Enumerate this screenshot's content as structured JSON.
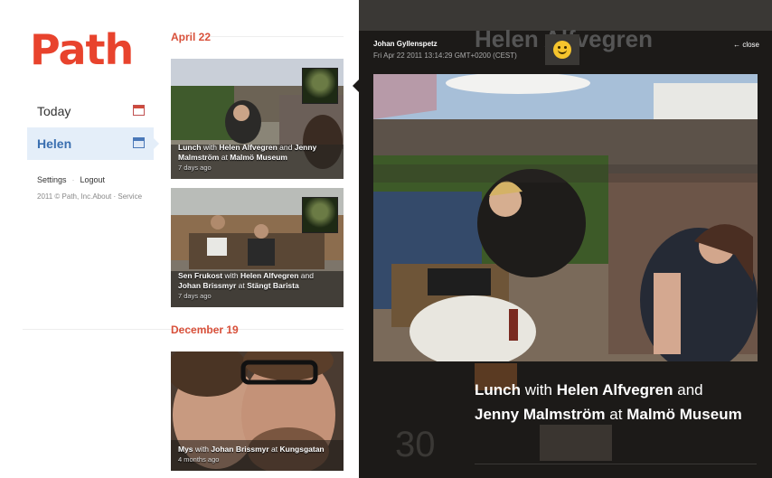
{
  "brand": {
    "logo_text": "Path"
  },
  "nav": {
    "items": [
      {
        "label": "Today"
      },
      {
        "label": "Helen"
      }
    ],
    "settings": "Settings",
    "logout": "Logout",
    "copyright": "2011 © Path, Inc.About · Service"
  },
  "feed": {
    "groups": [
      {
        "date": "April 22",
        "cards": [
          {
            "verb": "Lunch",
            "w1": "with",
            "p1": "Helen Alfvegren",
            "and": "and",
            "p2": "Jenny Malmström",
            "at": "at",
            "place": "Malmö Museum",
            "ago": "7 days ago"
          },
          {
            "verb": "Sen Frukost",
            "w1": "with",
            "p1": "Helen Alfvegren",
            "and": "and",
            "p2": "Johan Brissmyr",
            "at": "at",
            "place": "Stängt Barista",
            "ago": "7 days ago"
          }
        ]
      },
      {
        "date": "December 19",
        "cards": [
          {
            "verb": "Mys",
            "w1": "with",
            "p1": "Johan Brissmyr",
            "at": "at",
            "place": "Kungsgatan",
            "ago": "4 months ago"
          }
        ]
      }
    ]
  },
  "detail": {
    "author": "Johan Gyllenspetz",
    "datetime": "Fri Apr 22 2011 13:14:29 GMT+0200 (CEST)",
    "ghost_name": "Helen Alfvegren",
    "close": "← close",
    "emote_icon": "smiley-icon",
    "caption": {
      "verb": "Lunch",
      "w1": "with",
      "p1": "Helen Alfvegren",
      "and": "and",
      "p2": "Jenny Malmström",
      "at": "at",
      "place": "Malmö Museum"
    }
  },
  "colors": {
    "brand": "#e8432d",
    "accent": "#d8503a",
    "nav_active_bg": "#e4eef9"
  }
}
